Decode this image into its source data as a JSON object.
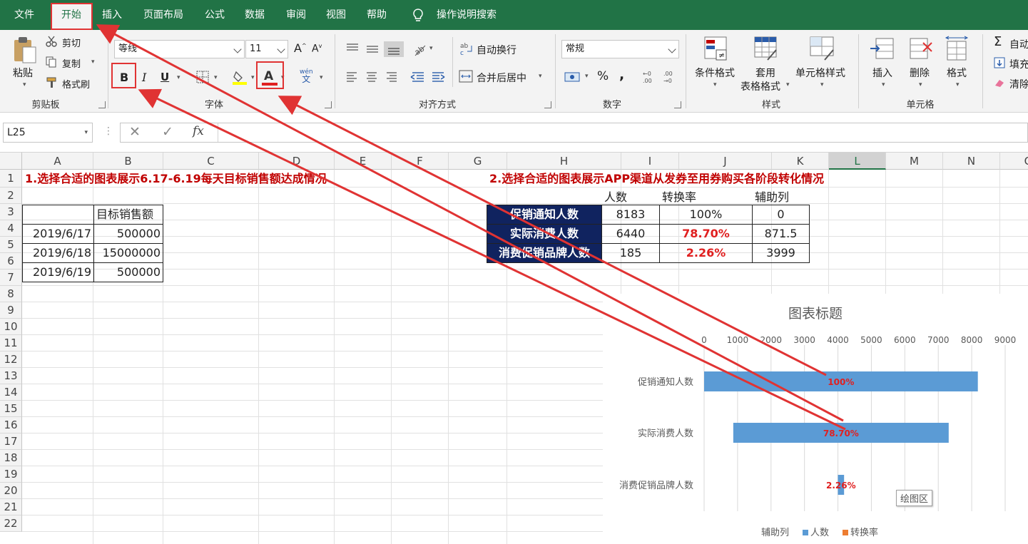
{
  "menu": {
    "tabs": [
      "文件",
      "开始",
      "插入",
      "页面布局",
      "公式",
      "数据",
      "审阅",
      "视图",
      "帮助"
    ],
    "active": "开始",
    "search_label": "操作说明搜索"
  },
  "ribbon": {
    "clipboard": {
      "paste": "粘贴",
      "cut": "剪切",
      "copy": "复制",
      "format_painter": "格式刷",
      "group_label": "剪贴板"
    },
    "font": {
      "font_name": "等线",
      "font_size": "11",
      "bold": "B",
      "italic": "I",
      "underline": "U",
      "font_color_letter": "A",
      "phonetic": "wén",
      "phonetic_sub": "文",
      "grow": "A",
      "shrink": "A",
      "group_label": "字体"
    },
    "alignment": {
      "wrap_text": "自动换行",
      "merge_center": "合并后居中",
      "group_label": "对齐方式"
    },
    "number": {
      "format": "常规",
      "percent": "%",
      "comma": ",",
      "inc_decimal": ".0→.00",
      "dec_decimal": ".00→.0",
      "group_label": "数字"
    },
    "styles": {
      "conditional": "条件格式",
      "table_line1": "套用",
      "table_line2": "表格格式",
      "cell_styles": "单元格样式",
      "group_label": "样式"
    },
    "cells": {
      "insert": "插入",
      "delete": "删除",
      "format": "格式",
      "group_label": "单元格"
    },
    "editing": {
      "autosum": "自动",
      "fill": "填充",
      "clear": "清除"
    }
  },
  "formula_bar": {
    "name_box": "L25",
    "fx": "fx",
    "formula": ""
  },
  "columns": [
    "A",
    "B",
    "C",
    "D",
    "E",
    "F",
    "G",
    "H",
    "I",
    "J",
    "K",
    "L",
    "M",
    "N",
    "O"
  ],
  "rows": [
    "1",
    "2",
    "3",
    "4",
    "5",
    "6",
    "7",
    "8",
    "9",
    "10",
    "11",
    "12",
    "13",
    "14",
    "15",
    "16",
    "17",
    "18",
    "19",
    "20",
    "21",
    "22"
  ],
  "sheet": {
    "title1": "1.选择合适的图表展示6.17-6.19每天目标销售额达成情况",
    "title2": "2.选择合适的图表展示APP渠道从发券至用券购买各阶段转化情况",
    "table1": {
      "header": "目标销售额",
      "rows": [
        {
          "date": "2019/6/17",
          "value": "500000"
        },
        {
          "date": "2019/6/18",
          "value": "15000000"
        },
        {
          "date": "2019/6/19",
          "value": "500000"
        }
      ]
    },
    "table2": {
      "headers": [
        "人数",
        "转换率",
        "辅助列"
      ],
      "rows": [
        {
          "label": "促销通知人数",
          "count": "8183",
          "rate": "100%",
          "helper": "0"
        },
        {
          "label": "实际消费人数",
          "count": "6440",
          "rate": "78.70%",
          "helper": "871.5"
        },
        {
          "label": "消费促销品牌人数",
          "count": "185",
          "rate": "2.26%",
          "helper": "3999"
        }
      ]
    }
  },
  "chart_data": {
    "type": "bar",
    "orientation": "horizontal",
    "stacked": true,
    "title": "图表标题",
    "categories": [
      "促销通知人数",
      "实际消费人数",
      "消费促销品牌人数"
    ],
    "series": [
      {
        "name": "辅助列",
        "values": [
          0,
          871.5,
          3999
        ],
        "color": "none"
      },
      {
        "name": "人数",
        "values": [
          8183,
          6440,
          185
        ],
        "color": "#5b9bd5"
      },
      {
        "name": "转换率",
        "values": [
          1,
          0.787,
          0.0226
        ],
        "color": "#ed7d31"
      }
    ],
    "data_labels": [
      "100%",
      "78.70%",
      "2.26%"
    ],
    "xlim": [
      0,
      9000
    ],
    "xticks": [
      "0",
      "1000",
      "2000",
      "3000",
      "4000",
      "5000",
      "6000",
      "7000",
      "8000",
      "9000"
    ],
    "xtick_values": [
      0,
      1000,
      2000,
      3000,
      4000,
      5000,
      6000,
      7000,
      8000,
      9000
    ],
    "grid": true,
    "legend_position": "bottom",
    "plot_area_tooltip": "绘图区"
  },
  "colors": {
    "excel_green": "#217346",
    "annotation_red": "#e03333",
    "navy": "#10235f",
    "label_red": "#c00000"
  }
}
